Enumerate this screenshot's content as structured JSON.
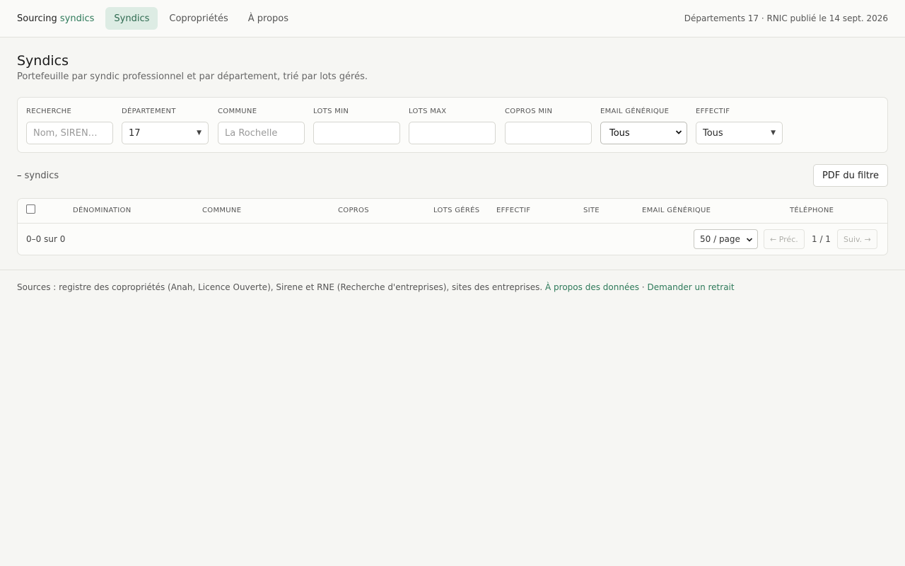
{
  "nav": {
    "brand_text": "Sourcing",
    "brand_accent": "syndics",
    "tabs": [
      {
        "label": "Syndics",
        "active": true
      },
      {
        "label": "Copropriétés",
        "active": false
      },
      {
        "label": "À propos",
        "active": false
      }
    ],
    "meta": "Départements 17 · RNIC publié le 14 sept. 2026"
  },
  "page": {
    "title": "Syndics",
    "subtitle": "Portefeuille par syndic professionnel et par département, trié par lots gérés."
  },
  "filters": {
    "recherche": {
      "label": "Recherche",
      "placeholder": "Nom, SIREN…",
      "value": ""
    },
    "departement": {
      "label": "Département",
      "value": "17"
    },
    "commune": {
      "label": "Commune",
      "placeholder": "La Rochelle",
      "value": ""
    },
    "lots_min": {
      "label": "Lots min",
      "value": ""
    },
    "lots_max": {
      "label": "Lots max",
      "value": ""
    },
    "copros_min": {
      "label": "Copros min",
      "value": ""
    },
    "email_generique": {
      "label": "Email générique",
      "value": "Tous"
    },
    "effectif": {
      "label": "Effectif",
      "value": "Tous"
    }
  },
  "results": {
    "count_dash": "–",
    "count_label": "syndics",
    "pdf_button": "PDF du filtre"
  },
  "table": {
    "columns": [
      "Dénomination",
      "Commune",
      "Copros",
      "Lots gérés",
      "Effectif",
      "Site",
      "Email générique",
      "Téléphone"
    ],
    "rows": [],
    "range": "0–0 sur 0",
    "per_page": "50 / page",
    "prev": "← Préc.",
    "page_info": "1 / 1",
    "next": "Suiv. →"
  },
  "footer": {
    "text": "Sources : registre des copropriétés (Anah, Licence Ouverte), Sirene et RNE (Recherche d'entreprises), sites des entreprises.",
    "link_about": "À propos des données",
    "separator": "·",
    "link_removal": "Demander un retrait"
  },
  "colors": {
    "accent": "#2e7a5a",
    "active_tab_bg": "#ddece4",
    "page_bg": "#f6f6f3"
  }
}
